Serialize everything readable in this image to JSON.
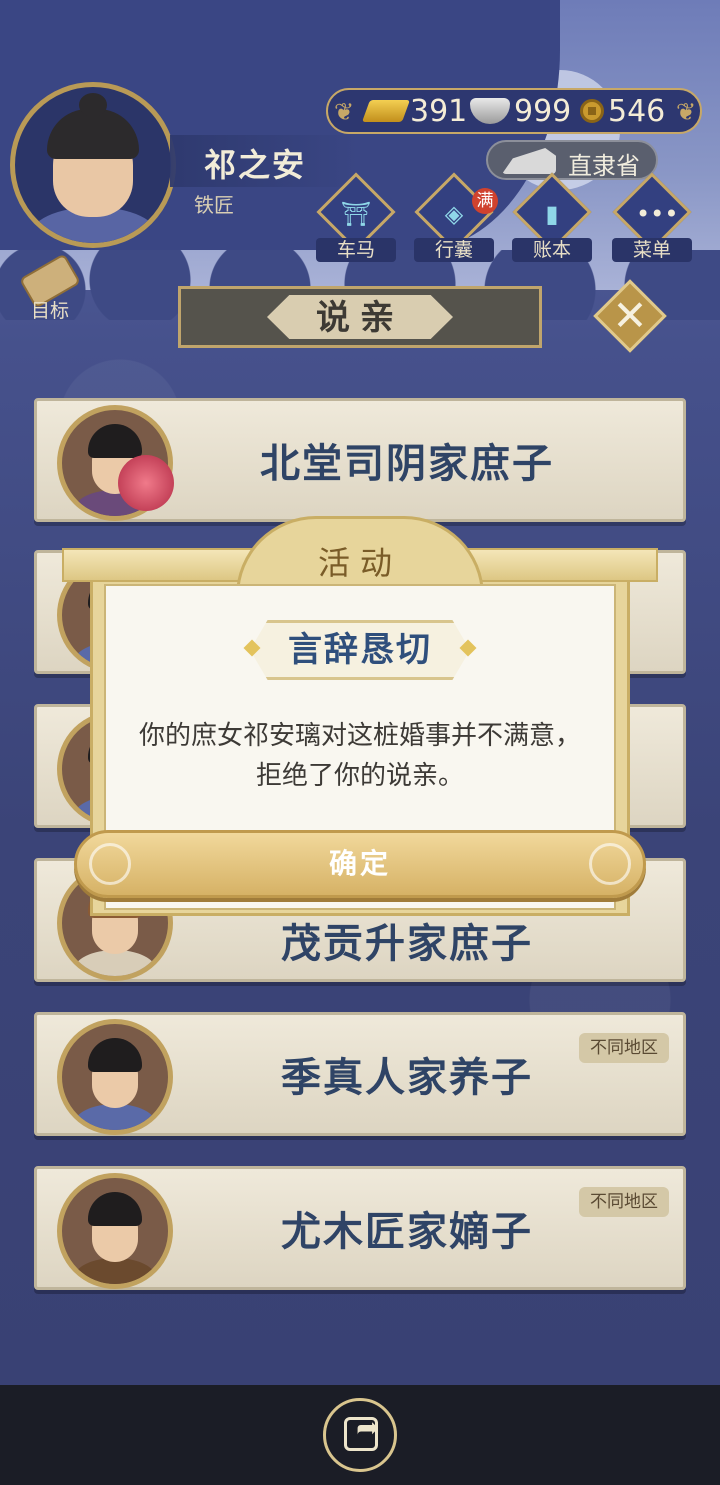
{
  "player": {
    "name": "祁之安",
    "job": "铁匠"
  },
  "resources": {
    "gold": "391",
    "silver": "999",
    "copper": "546"
  },
  "region": "直隶省",
  "nav": [
    {
      "label": "车马",
      "icon": "carriage-icon"
    },
    {
      "label": "行囊",
      "icon": "bag-icon",
      "badge": "满"
    },
    {
      "label": "账本",
      "icon": "ledger-icon"
    },
    {
      "label": "菜单",
      "icon": "menu-icon"
    }
  ],
  "goal_label": "目标",
  "panel_title": "说亲",
  "candidates": [
    {
      "name": "北堂司阴家庶子",
      "tag": ""
    },
    {
      "name": "",
      "tag": ""
    },
    {
      "name": "",
      "tag": ""
    },
    {
      "name": "茂贡升家庶子",
      "tag": ""
    },
    {
      "name": "季真人家养子",
      "tag": "不同地区"
    },
    {
      "name": "尤木匠家嫡子",
      "tag": "不同地区"
    }
  ],
  "modal": {
    "header": "活动",
    "subtitle": "言辞恳切",
    "message": "你的庶女祁安璃对这桩婚事并不满意，拒绝了你的说亲。",
    "confirm": "确定"
  },
  "colors": {
    "accent_gold": "#c7a867",
    "navy": "#3a4684",
    "name_blue": "#2f4466"
  }
}
